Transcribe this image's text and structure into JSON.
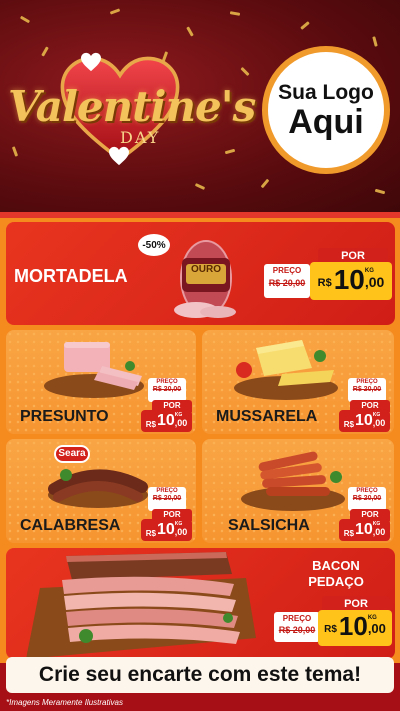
{
  "header": {
    "title": "Valentine's",
    "subtitle": "DAY",
    "logo_line1": "Sua Logo",
    "logo_line2": "Aqui"
  },
  "labels": {
    "preco": "PREÇO",
    "por": "POR",
    "currency": "R$",
    "unit": "KG"
  },
  "featured": {
    "name": "MORTADELA",
    "discount": "-50%",
    "old_price": "R$ 20,00",
    "price_int": "10",
    "price_dec": ",00",
    "brand": "OURO"
  },
  "products": [
    {
      "name": "PRESUNTO",
      "old_price": "R$ 20,00",
      "price_int": "10",
      "price_dec": ",00"
    },
    {
      "name": "MUSSARELA",
      "old_price": "R$ 20,00",
      "price_int": "10",
      "price_dec": ",00"
    },
    {
      "name": "CALABRESA",
      "old_price": "R$ 20,00",
      "price_int": "10",
      "price_dec": ",00",
      "brand": "Seara"
    },
    {
      "name": "SALSICHA",
      "old_price": "R$ 20,00",
      "price_int": "10",
      "price_dec": ",00"
    }
  ],
  "bacon": {
    "name_line1": "BACON",
    "name_line2": "PEDAÇO",
    "old_price": "R$ 20,00",
    "price_int": "10",
    "price_dec": ",00"
  },
  "footer": {
    "cta": "Crie seu encarte com este tema!",
    "disclaimer": "*Imagens Meramente Ilustrativas"
  },
  "colors": {
    "header_bg": "#5a0b0e",
    "accent_red": "#d2201a",
    "accent_orange": "#f69530",
    "price_yellow": "#ffc31a",
    "gold": "#f3c25a"
  }
}
